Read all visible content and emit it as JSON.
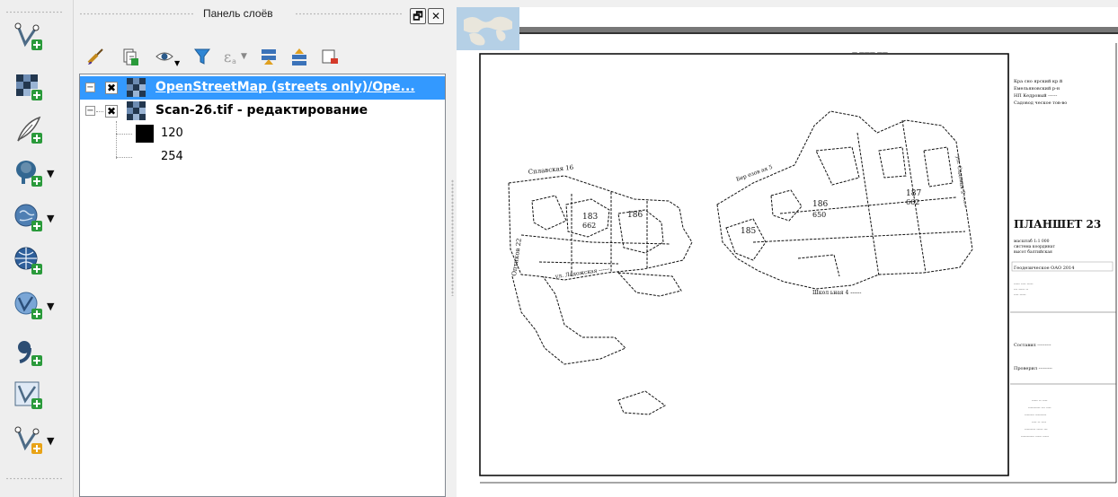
{
  "left_toolbar": {
    "tools": [
      {
        "name": "add-vector-layer",
        "has_dropdown": false
      },
      {
        "name": "add-raster-layer",
        "has_dropdown": false
      },
      {
        "name": "new-shapefile-layer",
        "has_dropdown": false
      },
      {
        "name": "add-postgis-layer",
        "has_dropdown": true
      },
      {
        "name": "add-wms-layer",
        "has_dropdown": true
      },
      {
        "name": "add-wcs-layer",
        "has_dropdown": false
      },
      {
        "name": "add-wfs-layer",
        "has_dropdown": true
      },
      {
        "name": "add-delimited-text-layer",
        "has_dropdown": false
      },
      {
        "name": "add-virtual-layer",
        "has_dropdown": false
      },
      {
        "name": "new-temporary-scratch-layer",
        "has_dropdown": true
      }
    ]
  },
  "layers_panel": {
    "title": "Панель слоёв",
    "float_button": "🗗",
    "close_button": "✕",
    "layers": [
      {
        "name": "OpenStreetMap (streets only)/Ope...",
        "selected": true,
        "checked": true,
        "expanded": false
      },
      {
        "name": "Scan-26.tif - редактирование",
        "selected": false,
        "checked": true,
        "expanded": true,
        "legend": [
          {
            "label": "120",
            "color": "#000000"
          },
          {
            "label": "254",
            "color": "#ffffff"
          }
        ]
      }
    ]
  },
  "map": {
    "sheet_title": "ПЛАНШЕТ 23",
    "parcel_labels": [
      "183",
      "662",
      "186",
      "185",
      "186",
      "187",
      "662"
    ],
    "colors": {
      "selection": "#3399ff",
      "canvas": "#ffffff",
      "ink": "#111111"
    }
  }
}
